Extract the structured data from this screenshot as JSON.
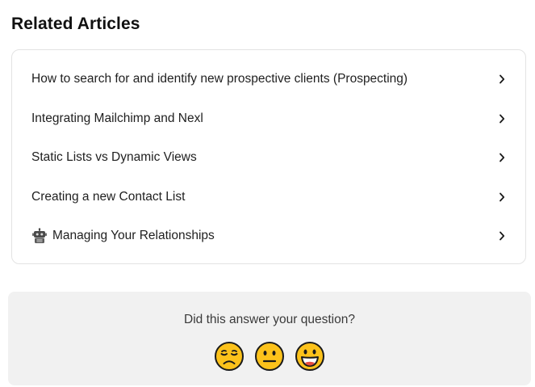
{
  "page": {
    "heading": "Related Articles"
  },
  "articles": [
    {
      "title": "How to search for and identify new prospective clients (Prospecting)",
      "icon": null
    },
    {
      "title": "Integrating Mailchimp and Nexl",
      "icon": null
    },
    {
      "title": "Static Lists vs Dynamic Views",
      "icon": null
    },
    {
      "title": "Creating a new Contact List",
      "icon": null
    },
    {
      "title": "Managing Your Relationships",
      "icon": "robot-icon"
    }
  ],
  "feedback": {
    "question": "Did this answer your question?",
    "reactions": [
      {
        "name": "disappointed-face",
        "label": "😔"
      },
      {
        "name": "neutral-face",
        "label": "😐"
      },
      {
        "name": "smiley-face",
        "label": "😃"
      }
    ],
    "emoji_color": "#fcc21b"
  },
  "colors": {
    "card_border": "#e3e3e3",
    "feedback_bg": "#f1f1f1",
    "text": "#1f1f1f"
  }
}
